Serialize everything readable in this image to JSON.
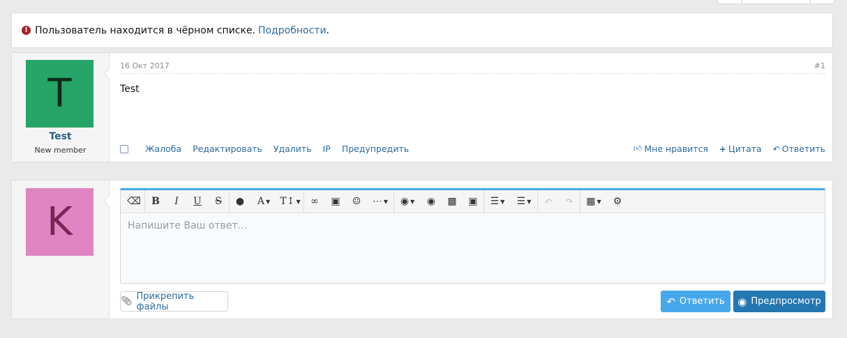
{
  "notice": {
    "text": "Пользователь находится в чёрном списке.",
    "link": "Подробности",
    "period": "."
  },
  "message": {
    "author": {
      "avatar_letter": "T",
      "avatar_color": "#27a467",
      "avatar_text_color": "#0f2a1b",
      "username": "Test",
      "title": "New member"
    },
    "date": "16 Окт 2017",
    "number": "#1",
    "body": "Test",
    "actions_left": [
      "Жалоба",
      "Редактировать",
      "Удалить",
      "IP",
      "Предупредить"
    ],
    "actions_right": [
      {
        "label": "Мне нравится",
        "icon": "thumbs-up-icon"
      },
      {
        "label": "Цитата",
        "icon": "plus-icon"
      },
      {
        "label": "Ответить",
        "icon": "reply-icon"
      }
    ]
  },
  "reply": {
    "avatar_letter": "K",
    "avatar_color": "#e085c2",
    "avatar_text_color": "#7a2456",
    "placeholder": "Напишите Ваш ответ...",
    "attach_label": "Прикрепить файлы",
    "reply_label": "Ответить",
    "preview_label": "Предпросмотр"
  },
  "colors": {
    "accent": "#47a7eb",
    "link": "#2b6aa0",
    "preview_button": "#2577b1",
    "warning": "#a7212c"
  }
}
